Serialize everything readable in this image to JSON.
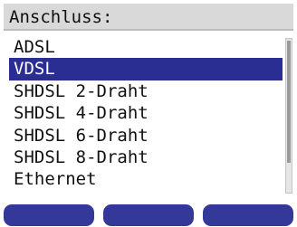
{
  "title": "Anschluss:",
  "list": {
    "items": [
      "ADSL",
      "VDSL",
      "SHDSL 2-Draht",
      "SHDSL 4-Draht",
      "SHDSL 6-Draht",
      "SHDSL 8-Draht",
      "Ethernet"
    ],
    "selected_index": 1
  },
  "softkeys": [
    "",
    "",
    ""
  ],
  "colors": {
    "selection": "#2a2e92",
    "softkey": "#343898",
    "title_bg": "#d9d9d9"
  }
}
